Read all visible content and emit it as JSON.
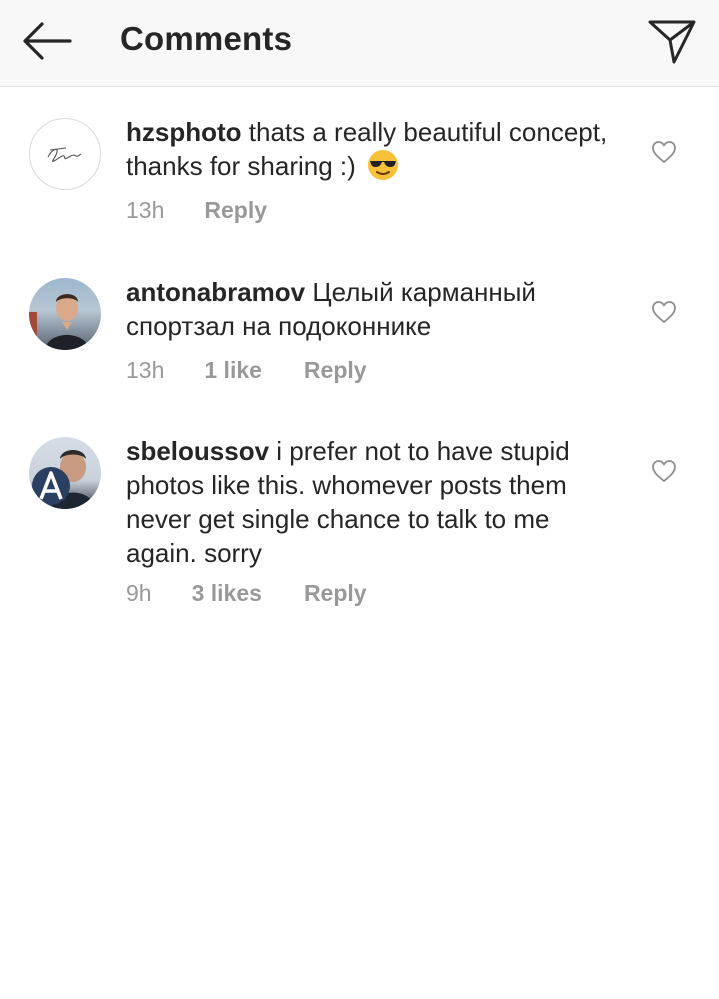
{
  "header": {
    "title": "Comments",
    "back_icon": "arrow-left-icon",
    "send_icon": "paper-plane-icon"
  },
  "comments": [
    {
      "username": "hzsphoto",
      "text": "thats a really beautiful concept, thanks for sharing :)",
      "emoji": "sunglasses-emoji",
      "time": "13h",
      "likes": "",
      "reply": "Reply"
    },
    {
      "username": "antonabramov",
      "text": "Целый карманный спортзал на подоконнике",
      "time": "13h",
      "likes": "1 like",
      "reply": "Reply"
    },
    {
      "username": "sbeloussov",
      "text": "i prefer not to have stupid photos like this. whomever posts them never get single chance to talk to me again. sorry",
      "time": "9h",
      "likes": "3 likes",
      "reply": "Reply"
    }
  ],
  "colors": {
    "text": "#262626",
    "meta": "#999999",
    "header_bg": "#f8f8f8"
  }
}
